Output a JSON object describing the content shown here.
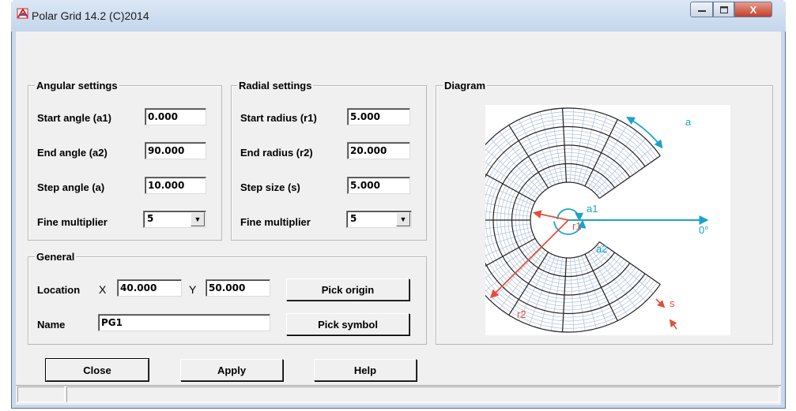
{
  "window": {
    "title": "Polar Grid 14.2 (C)2014",
    "close_glyph": "X"
  },
  "angular": {
    "legend": "Angular settings",
    "start_label": "Start angle (a1)",
    "start_value": "0.000",
    "end_label": "End angle (a2)",
    "end_value": "90.000",
    "step_label": "Step angle (a)",
    "step_value": "10.000",
    "fine_label": "Fine multiplier",
    "fine_value": "5"
  },
  "radial": {
    "legend": "Radial settings",
    "start_label": "Start radius (r1)",
    "start_value": "5.000",
    "end_label": "End radius (r2)",
    "end_value": "20.000",
    "step_label": "Step size (s)",
    "step_value": "5.000",
    "fine_label": "Fine multiplier",
    "fine_value": "5"
  },
  "general": {
    "legend": "General",
    "location_label": "Location",
    "x_label": "X",
    "x_value": "40.000",
    "y_label": "Y",
    "y_value": "50.000",
    "pick_origin": "Pick origin",
    "name_label": "Name",
    "name_value": "PG1",
    "pick_symbol": "Pick symbol"
  },
  "diagram": {
    "legend": "Diagram",
    "labels": {
      "a": "a",
      "a1": "a1",
      "a2": "a2",
      "r1": "r1",
      "r2": "r2",
      "s": "s",
      "zero": "0°"
    },
    "colors": {
      "teal": "#1aa3c9",
      "red": "#e0503c",
      "grid_fine": "#b8c6dc",
      "grid": "#222222"
    }
  },
  "buttons": {
    "close": "Close",
    "apply": "Apply",
    "help": "Help"
  }
}
